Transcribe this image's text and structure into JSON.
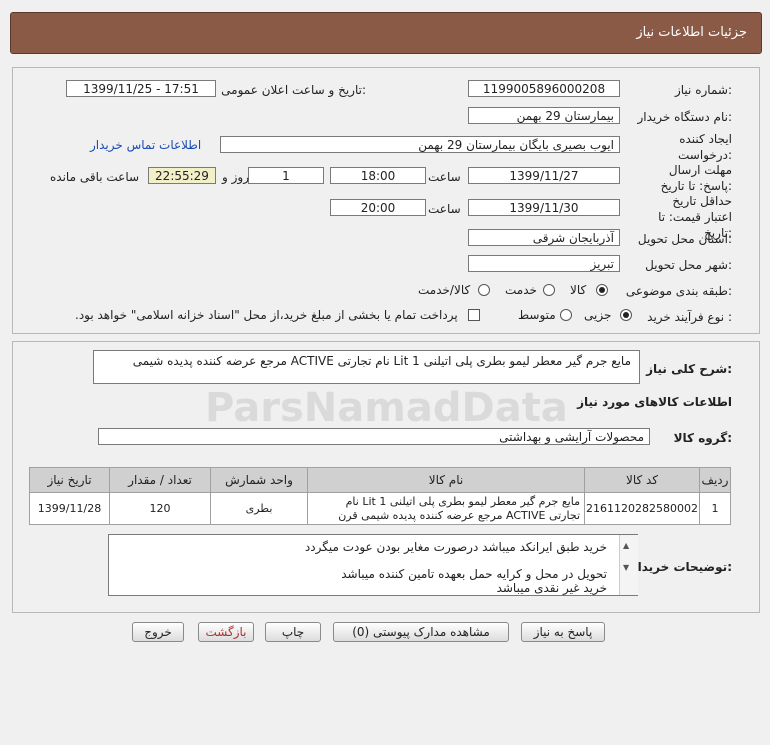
{
  "header": {
    "title": "جزئیات اطلاعات نیاز"
  },
  "form": {
    "need_number_label": "شماره نیاز:",
    "need_number": "1199005896000208",
    "announce_label": "تاریخ و ساعت اعلان عمومی:",
    "announce_value": "1399/11/25 - 17:51",
    "buyer_org_label": "نام دستگاه خریدار:",
    "buyer_org": "بیمارستان 29 بهمن",
    "creator_label": "ایجاد کننده درخواست:",
    "creator": "ایوب بصیری  بایگان بیمارستان 29 بهمن",
    "contact_link": "اطلاعات تماس خریدار",
    "deadline_label": "مهلت ارسال پاسخ: تا تاریخ:",
    "deadline_date": "1399/11/27",
    "time_label": "ساعت",
    "deadline_time": "18:00",
    "days_value": "1",
    "days_label": "روز و",
    "remaining_time": "22:55:29",
    "remaining_label": "ساعت باقی مانده",
    "validity_label": "حداقل تاریخ اعتبار قیمت: تا تاریخ:",
    "validity_date": "1399/11/30",
    "validity_time": "20:00",
    "province_label": "استان محل تحویل:",
    "province": "آذربایجان شرقی",
    "city_label": "شهر محل تحویل:",
    "city": "تبریز",
    "category_label": "طبقه بندی موضوعی:",
    "category_options": [
      "کالا",
      "خدمت",
      "کالا/خدمت"
    ],
    "purchase_label": "نوع فرآیند خرید :",
    "purchase_options": [
      "جزیی",
      "متوسط"
    ],
    "purchase_note": "پرداخت تمام یا بخشی از مبلغ خرید،از محل \"اسناد خزانه اسلامی\" خواهد بود."
  },
  "description": {
    "label": "شرح کلی نیاز:",
    "text": "مایع جرم گیر معطر لیمو بطری پلی اتیلنی 1 Lit نام تجارتی ACTIVE مرجع عرضه کننده پدیده شیمی"
  },
  "goods": {
    "section_title": "اطلاعات کالاهای مورد نیاز",
    "group_label": "گروه کالا:",
    "group_value": "محصولات آرایشی و بهداشتی"
  },
  "table": {
    "headers": [
      "ردیف",
      "کد کالا",
      "نام کالا",
      "واحد شمارش",
      "تعداد / مقدار",
      "تاریخ نیاز"
    ],
    "rows": [
      {
        "index": "1",
        "code": "2161120282580002",
        "name": "مایع جرم گیر معطر لیمو بطری پلی اتیلنی 1 Lit نام تجارتی ACTIVE مرجع عرضه کننده پدیده شیمی قرن",
        "unit": "بطری",
        "qty": "120",
        "date": "1399/11/28"
      }
    ]
  },
  "notes": {
    "label": "توضیحات خریدار:",
    "lines": [
      "خرید طبق ایرانکد میباشد درصورت مغایر بودن عودت میگردد",
      "تحویل در محل و کرایه حمل بعهده تامین کننده میباشد",
      "خرید غیر نقدی میباشد"
    ]
  },
  "buttons": {
    "reply": "پاسخ به نیاز",
    "attachments": "مشاهده مدارک پیوستی (0)",
    "print": "چاپ",
    "back": "بازگشت",
    "exit": "خروج"
  },
  "watermark": {
    "brand": "ParsNamadData"
  },
  "colors": {
    "header_bg": "#8a5a47",
    "link": "#1a4bb8",
    "remaining_bg": "#f3efc8",
    "back_text": "#b03030"
  }
}
